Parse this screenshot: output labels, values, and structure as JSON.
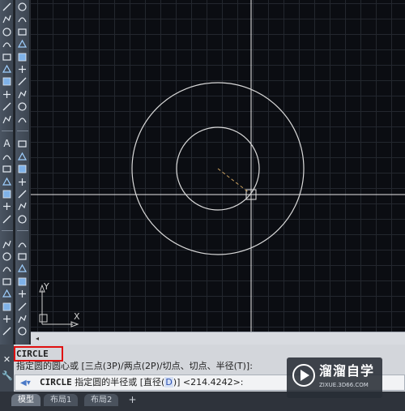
{
  "command": {
    "history_1": "CIRCLE",
    "history_2": "指定圆的圆心或 [三点(3P)/两点(2P)/切点、切点、半径(T)]:",
    "input_keyword": "CIRCLE",
    "input_prefix": " 指定圆的半径或 [直径(",
    "input_option_key": "D",
    "input_suffix": ")] <214.4242>:"
  },
  "ucs": {
    "x_label": "X",
    "y_label": "Y"
  },
  "tabs": [
    {
      "label": "模型",
      "active": true
    },
    {
      "label": "布局1",
      "active": false
    },
    {
      "label": "布局2",
      "active": false
    }
  ],
  "tab_add_label": "+",
  "scroll_arrow": "◂",
  "toolbar_letter": "A",
  "side_icons": {
    "close": "✕",
    "settings": "🔧"
  },
  "watermark": {
    "title": "溜溜自学",
    "url": "ZIXUE.3D66.COM"
  },
  "colors": {
    "canvas_bg": "#0b0d12",
    "geometry": "#d9d9d9",
    "crosshair": "#e8e8e8",
    "radius_preview": "#c8a060",
    "highlight_border": "#e01010"
  },
  "icons": [
    "line-icon",
    "polyline-icon",
    "circle-icon",
    "arc-icon",
    "rectangle-icon",
    "text-icon",
    "hatch-icon",
    "move-icon",
    "copy-icon",
    "rotate-icon",
    "trim-icon",
    "extend-icon"
  ]
}
